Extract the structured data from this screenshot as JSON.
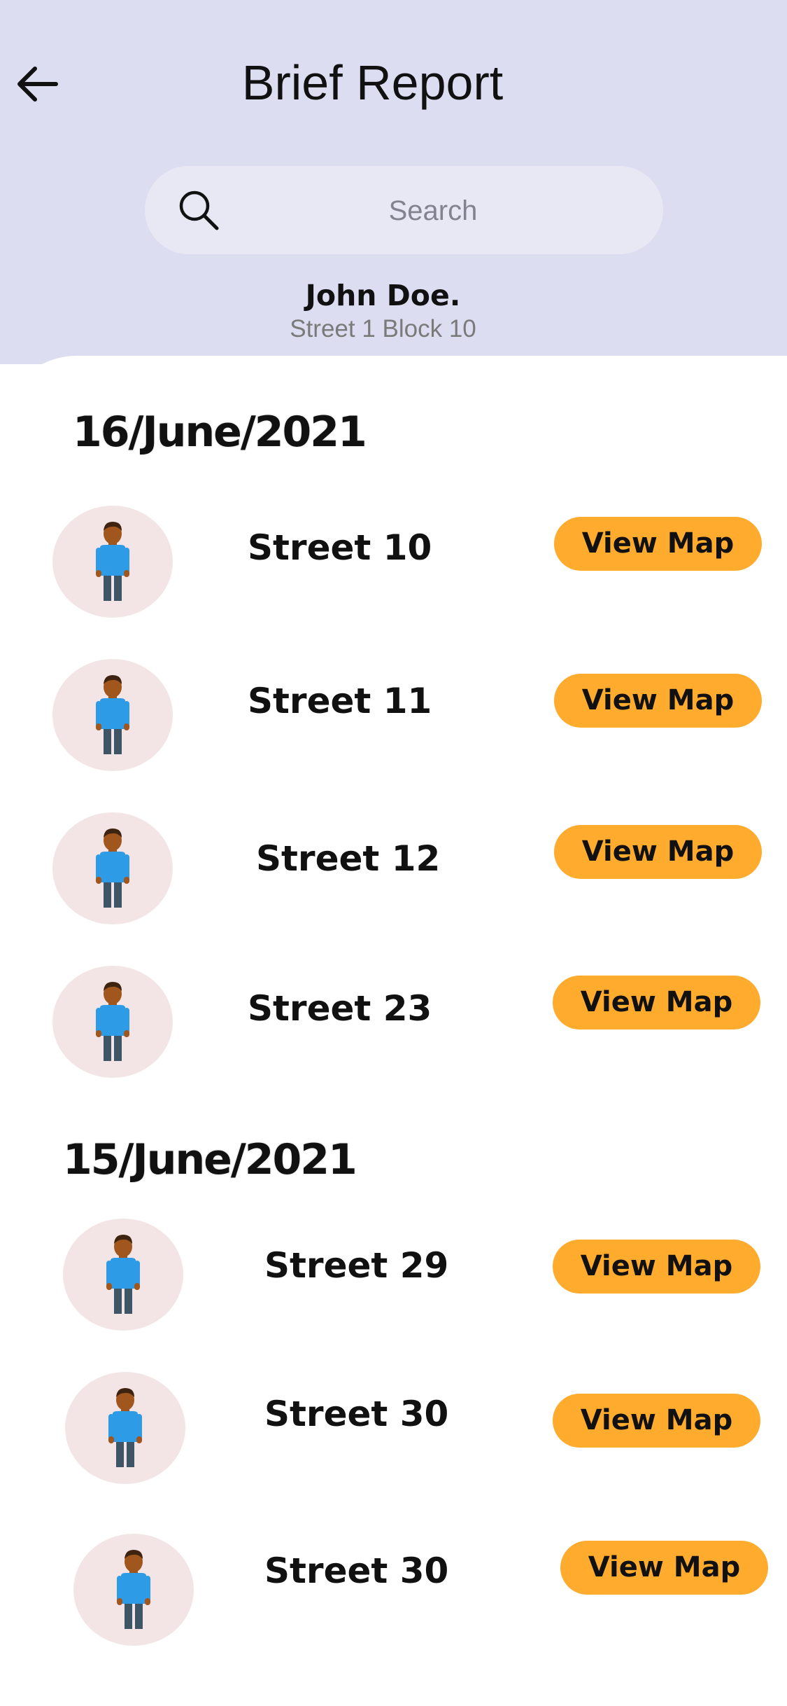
{
  "header": {
    "title": "Brief Report",
    "back_icon": "arrow-left-icon"
  },
  "search": {
    "placeholder": "Search",
    "value": "",
    "icon": "search-icon"
  },
  "user": {
    "name": "John Doe.",
    "address": "Street 1 Block 10"
  },
  "colors": {
    "header_background": "#DDDDF1",
    "search_background": "#E8E8F5",
    "button_accent": "#FFAB2E",
    "avatar_background": "#F3E5E5"
  },
  "groups": [
    {
      "date": "16/June/2021",
      "items": [
        {
          "street": "Street 10",
          "button_label": "View Map",
          "avatar_icon": "person-avatar-icon"
        },
        {
          "street": "Street 11",
          "button_label": "View Map",
          "avatar_icon": "person-avatar-icon"
        },
        {
          "street": "Street 12",
          "button_label": "View Map",
          "avatar_icon": "person-avatar-icon"
        },
        {
          "street": "Street 23",
          "button_label": "View Map",
          "avatar_icon": "person-avatar-icon"
        }
      ]
    },
    {
      "date": "15/June/2021",
      "items": [
        {
          "street": "Street 29",
          "button_label": "View Map",
          "avatar_icon": "person-avatar-icon"
        },
        {
          "street": "Street 30",
          "button_label": "View Map",
          "avatar_icon": "person-avatar-icon"
        },
        {
          "street": "Street 30",
          "button_label": "View Map",
          "avatar_icon": "person-avatar-icon"
        }
      ]
    }
  ]
}
